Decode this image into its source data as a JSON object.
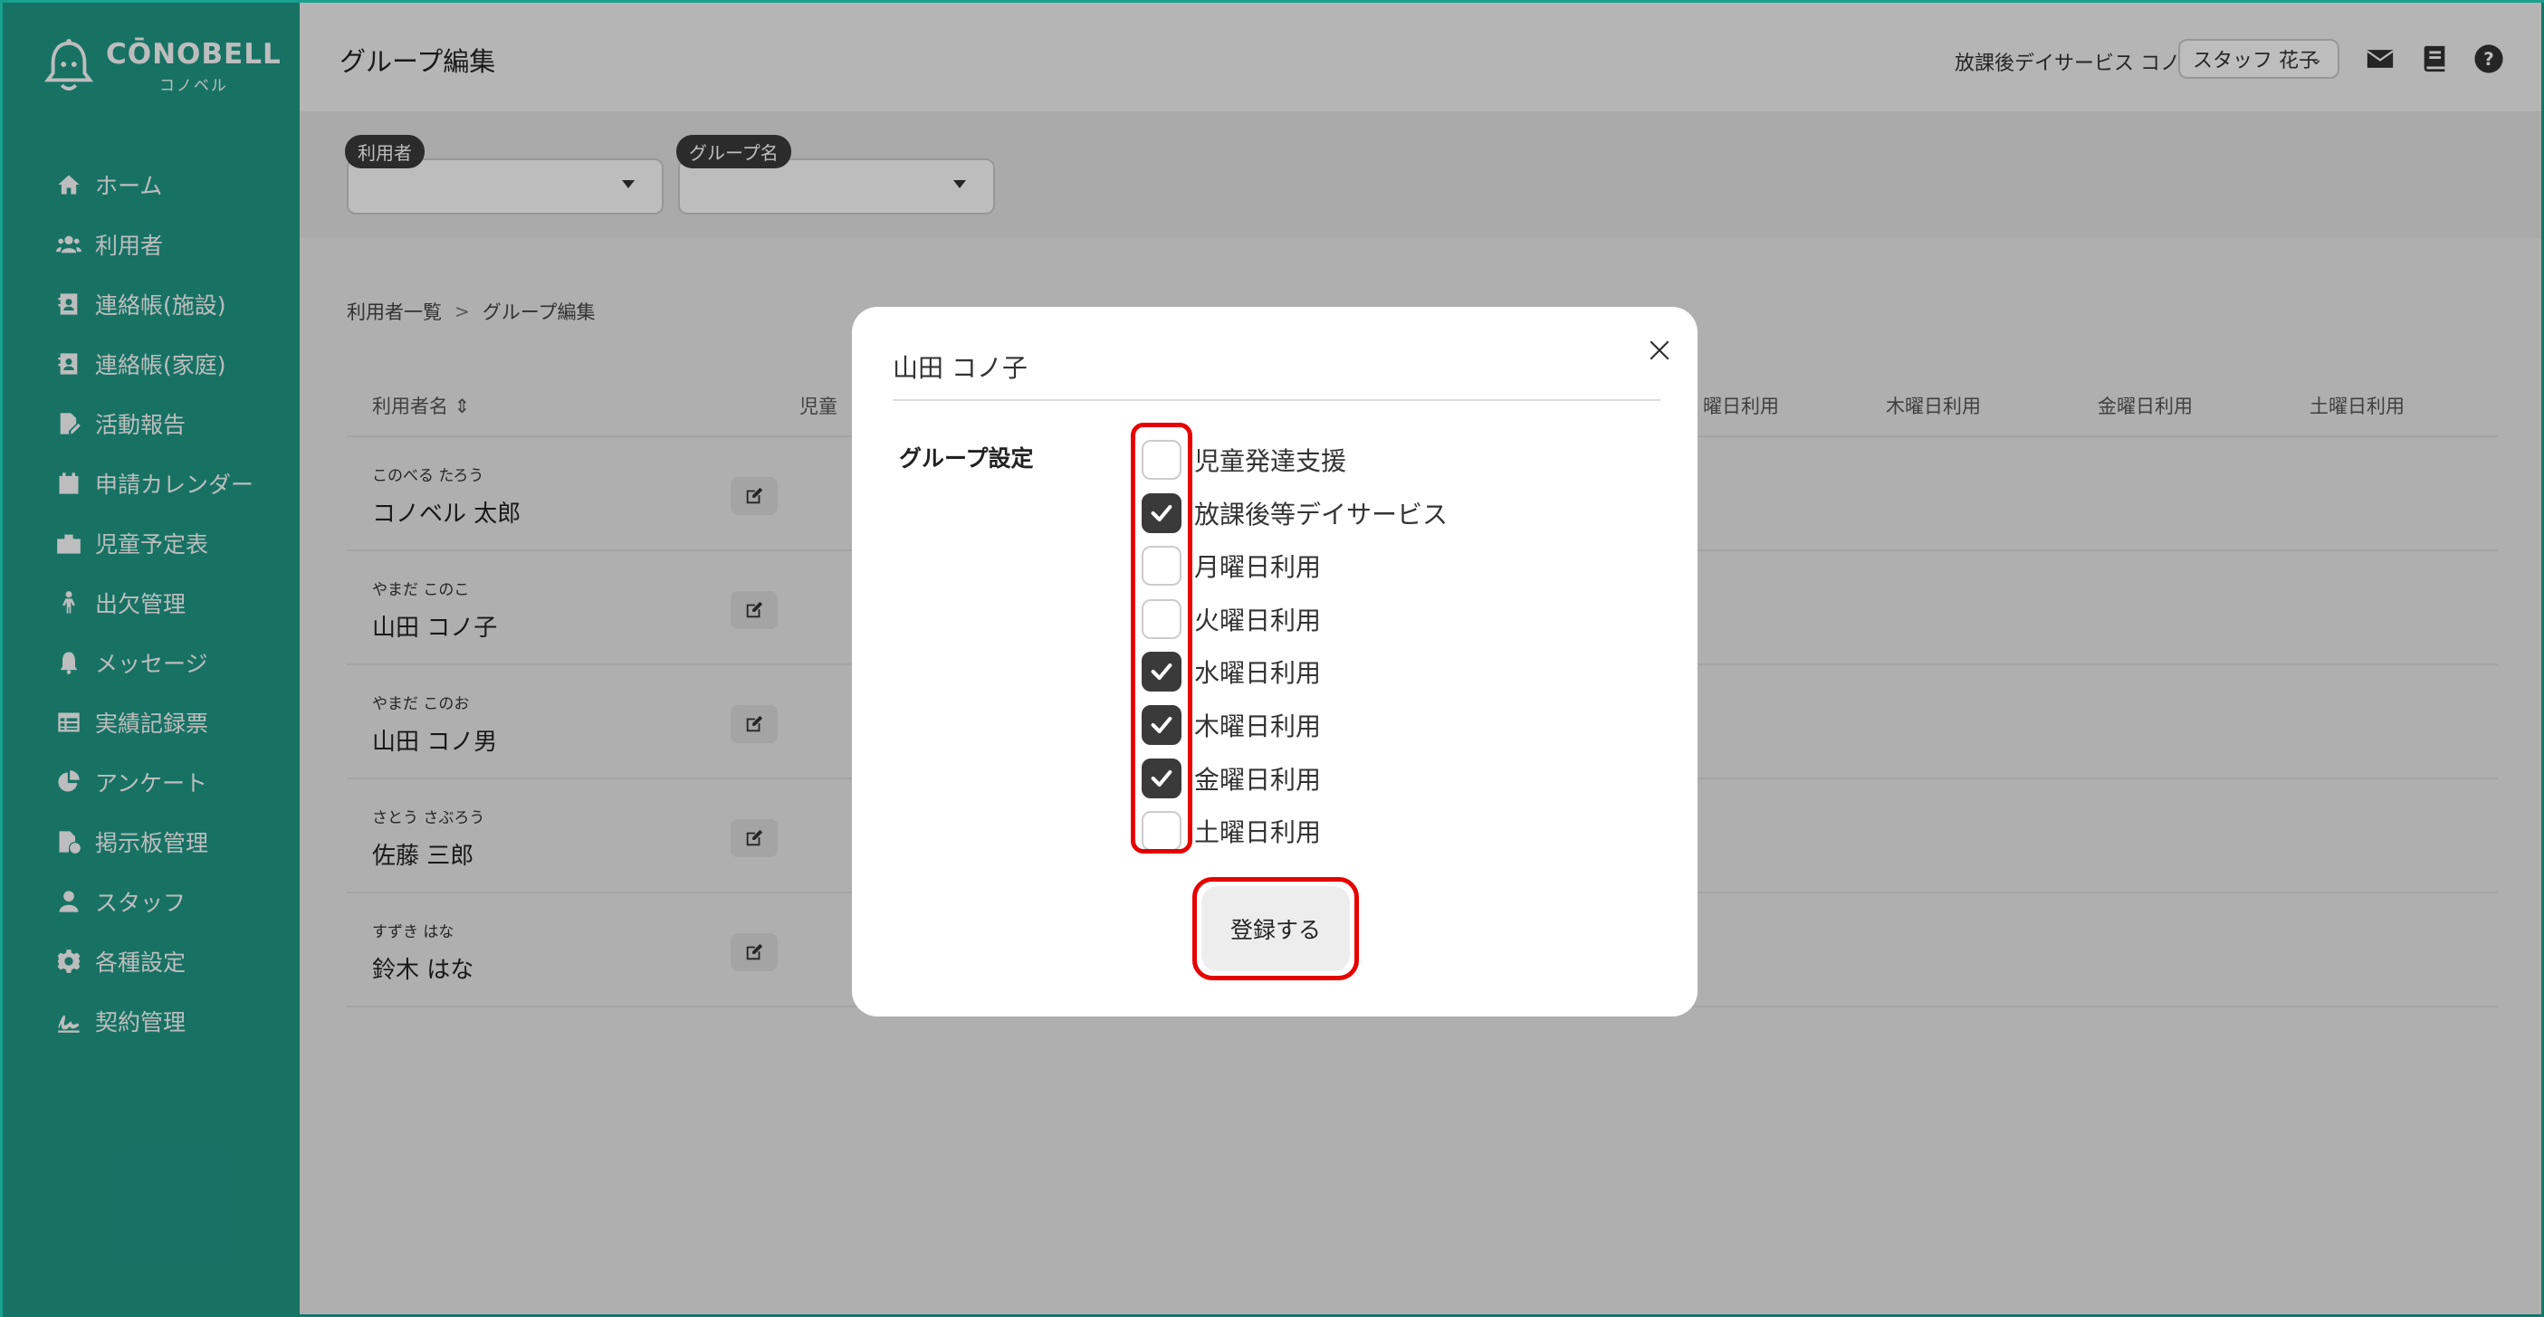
{
  "sidebar": {
    "logo": {
      "main": "CŌNOBELL",
      "sub": "コノベル"
    },
    "items": [
      {
        "label": "ホーム",
        "icon": "home-icon"
      },
      {
        "label": "利用者",
        "icon": "users-icon"
      },
      {
        "label": "連絡帳(施設)",
        "icon": "address-book-icon"
      },
      {
        "label": "連絡帳(家庭)",
        "icon": "address-book-icon"
      },
      {
        "label": "活動報告",
        "icon": "file-pen-icon"
      },
      {
        "label": "申請カレンダー",
        "icon": "calendar-icon"
      },
      {
        "label": "児童予定表",
        "icon": "building-icon"
      },
      {
        "label": "出欠管理",
        "icon": "child-icon"
      },
      {
        "label": "メッセージ",
        "icon": "bell-icon"
      },
      {
        "label": "実績記録票",
        "icon": "table-icon"
      },
      {
        "label": "アンケート",
        "icon": "chart-pie-icon"
      },
      {
        "label": "掲示板管理",
        "icon": "file-gear-icon"
      },
      {
        "label": "スタッフ",
        "icon": "user-icon"
      },
      {
        "label": "各種設定",
        "icon": "gear-icon"
      },
      {
        "label": "契約管理",
        "icon": "signature-icon"
      }
    ]
  },
  "header": {
    "title": "グループ編集",
    "facility": "放課後デイサービス コノベル",
    "staff_select": "スタッフ 花子"
  },
  "filters": {
    "user_label": "利用者",
    "group_label": "グループ名"
  },
  "breadcrumb": {
    "parent": "利用者一覧",
    "sep": ">",
    "current": "グループ編集"
  },
  "table": {
    "headers": {
      "name": "利用者名 ⇕",
      "col2": "児童",
      "wed": "曜日利用",
      "thu": "木曜日利用",
      "fri": "金曜日利用",
      "sat": "土曜日利用"
    },
    "rows": [
      {
        "kana": "このべる たろう",
        "name": "コノベル 太郎"
      },
      {
        "kana": "やまだ このこ",
        "name": "山田 コノ子"
      },
      {
        "kana": "やまだ このお",
        "name": "山田 コノ男"
      },
      {
        "kana": "さとう さぶろう",
        "name": "佐藤 三郎"
      },
      {
        "kana": "すずき はな",
        "name": "鈴木 はな"
      }
    ]
  },
  "modal": {
    "title": "山田 コノ子",
    "group_label": "グループ設定",
    "checkboxes": [
      {
        "label": "児童発達支援",
        "checked": false
      },
      {
        "label": "放課後等デイサービス",
        "checked": true
      },
      {
        "label": "月曜日利用",
        "checked": false
      },
      {
        "label": "火曜日利用",
        "checked": false
      },
      {
        "label": "水曜日利用",
        "checked": true
      },
      {
        "label": "木曜日利用",
        "checked": true
      },
      {
        "label": "金曜日利用",
        "checked": true
      },
      {
        "label": "土曜日利用",
        "checked": false
      }
    ],
    "submit_label": "登録する"
  }
}
